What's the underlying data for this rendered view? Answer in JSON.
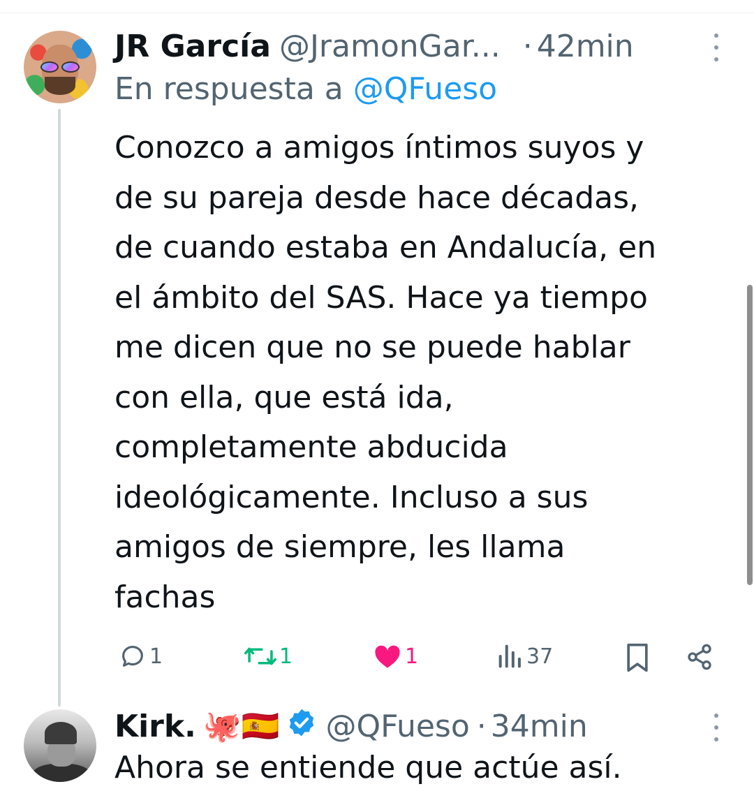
{
  "tweet1": {
    "display_name": "JR García",
    "handle": "@JramonGar...",
    "separator": "·",
    "time": "42min",
    "reply_prefix": "En respuesta a",
    "reply_mention": "@QFueso",
    "text_lines": [
      "Conozco a amigos íntimos suyos y",
      "de su pareja desde hace décadas,",
      "de cuando estaba en Andalucía, en",
      "el ámbito del SAS. Hace ya tiempo",
      "me dicen que no se puede hablar",
      "con ella, que está ida,",
      "completamente abducida",
      "ideológicamente. Incluso a sus",
      "amigos de siempre, les llama",
      "fachas"
    ],
    "actions": {
      "replies": "1",
      "retweets": "1",
      "likes": "1",
      "views": "37"
    },
    "colors": {
      "retweet": "#00ba7c",
      "like": "#f91880",
      "icon": "#536471"
    }
  },
  "tweet2": {
    "display_name": "Kirk.",
    "emojis": "🐙🇪🇸",
    "handle": "@QFueso",
    "separator": "·",
    "time": "34min",
    "text": "Ahora se entiende que actúe así."
  },
  "icons": {
    "reply": "reply-icon",
    "retweet": "retweet-icon",
    "like": "heart-icon",
    "views": "views-icon",
    "bookmark": "bookmark-icon",
    "share": "share-icon",
    "more": "more-icon",
    "verified": "verified-badge-icon"
  }
}
